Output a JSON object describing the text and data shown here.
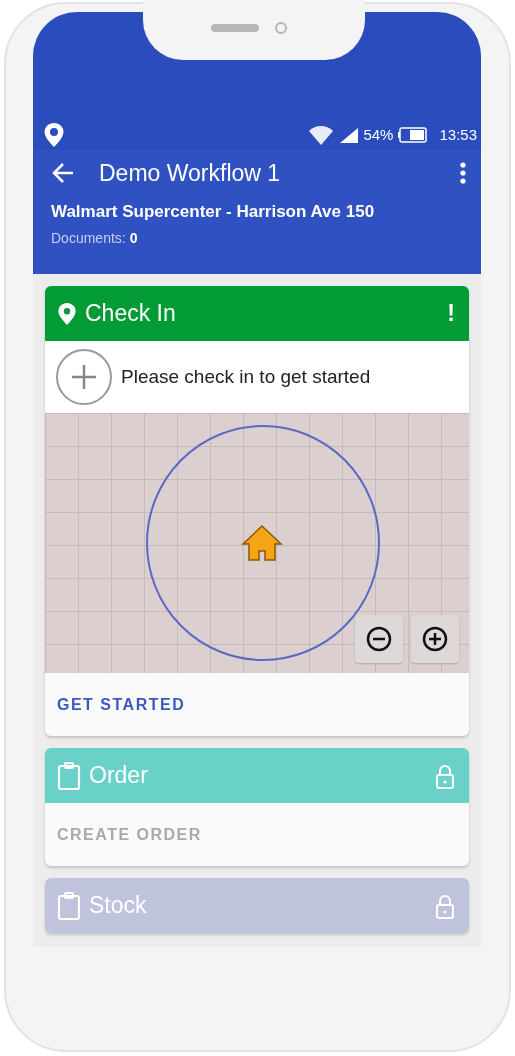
{
  "status_bar": {
    "battery": "54%",
    "time": "13:53"
  },
  "app_bar": {
    "title": "Demo Workflow 1",
    "store": "Walmart Supercenter - Harrison Ave 150",
    "documents_label": "Documents:",
    "documents_count": "0"
  },
  "steps": [
    {
      "kind": "checkin",
      "title": "Check In",
      "color": "#039b36",
      "locked": false,
      "status_mark": "!",
      "prompt": "Please check in to get started",
      "action": {
        "label": "GET STARTED",
        "disabled": false
      }
    },
    {
      "kind": "document",
      "title": "Order",
      "color": "#6ad1c9",
      "locked": true,
      "action": {
        "label": "CREATE ORDER",
        "disabled": true
      }
    },
    {
      "kind": "document",
      "title": "Stock",
      "color": "#c0c3dc",
      "locked": true
    }
  ]
}
